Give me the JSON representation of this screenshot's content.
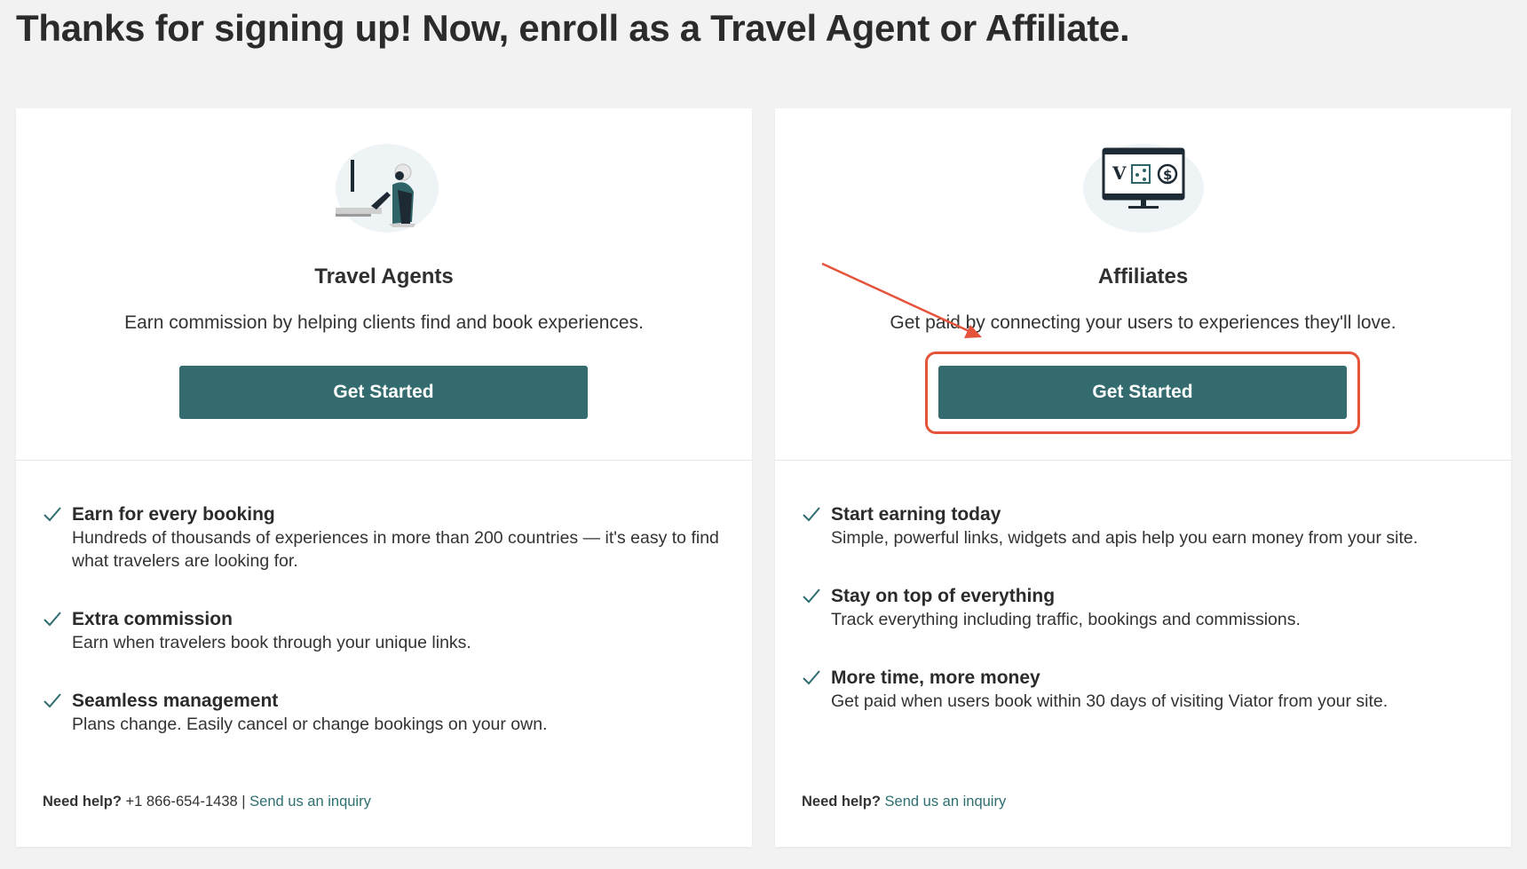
{
  "page": {
    "title": "Thanks for signing up! Now, enroll as a Travel Agent or Affiliate."
  },
  "colors": {
    "button": "#336b6e",
    "link": "#2e6e70",
    "highlight": "#e5533b"
  },
  "cards": {
    "travel_agents": {
      "icon": "travel-agent-illustration",
      "title": "Travel Agents",
      "description": "Earn commission by helping clients find and book experiences.",
      "button_label": "Get Started",
      "features": [
        {
          "title": "Earn for every booking",
          "description": "Hundreds of thousands of experiences in more than 200 countries — it's easy to find what travelers are looking for."
        },
        {
          "title": "Extra commission",
          "description": "Earn when travelers book through your unique links."
        },
        {
          "title": "Seamless management",
          "description": "Plans change. Easily cancel or change bookings on your own."
        }
      ],
      "help_label": "Need help?",
      "help_phone": "+1 866-654-1438 |",
      "help_link": "Send us an inquiry"
    },
    "affiliates": {
      "icon": "affiliate-monitor-illustration",
      "title": "Affiliates",
      "description": "Get paid by connecting your users to experiences they'll love.",
      "button_label": "Get Started",
      "features": [
        {
          "title": "Start earning today",
          "description": "Simple, powerful links, widgets and apis help you earn money from your site."
        },
        {
          "title": "Stay on top of everything",
          "description": "Track everything including traffic, bookings and commissions."
        },
        {
          "title": "More time, more money",
          "description": "Get paid when users book within 30 days of visiting Viator from your site."
        }
      ],
      "help_label": "Need help?",
      "help_link": "Send us an inquiry"
    }
  }
}
